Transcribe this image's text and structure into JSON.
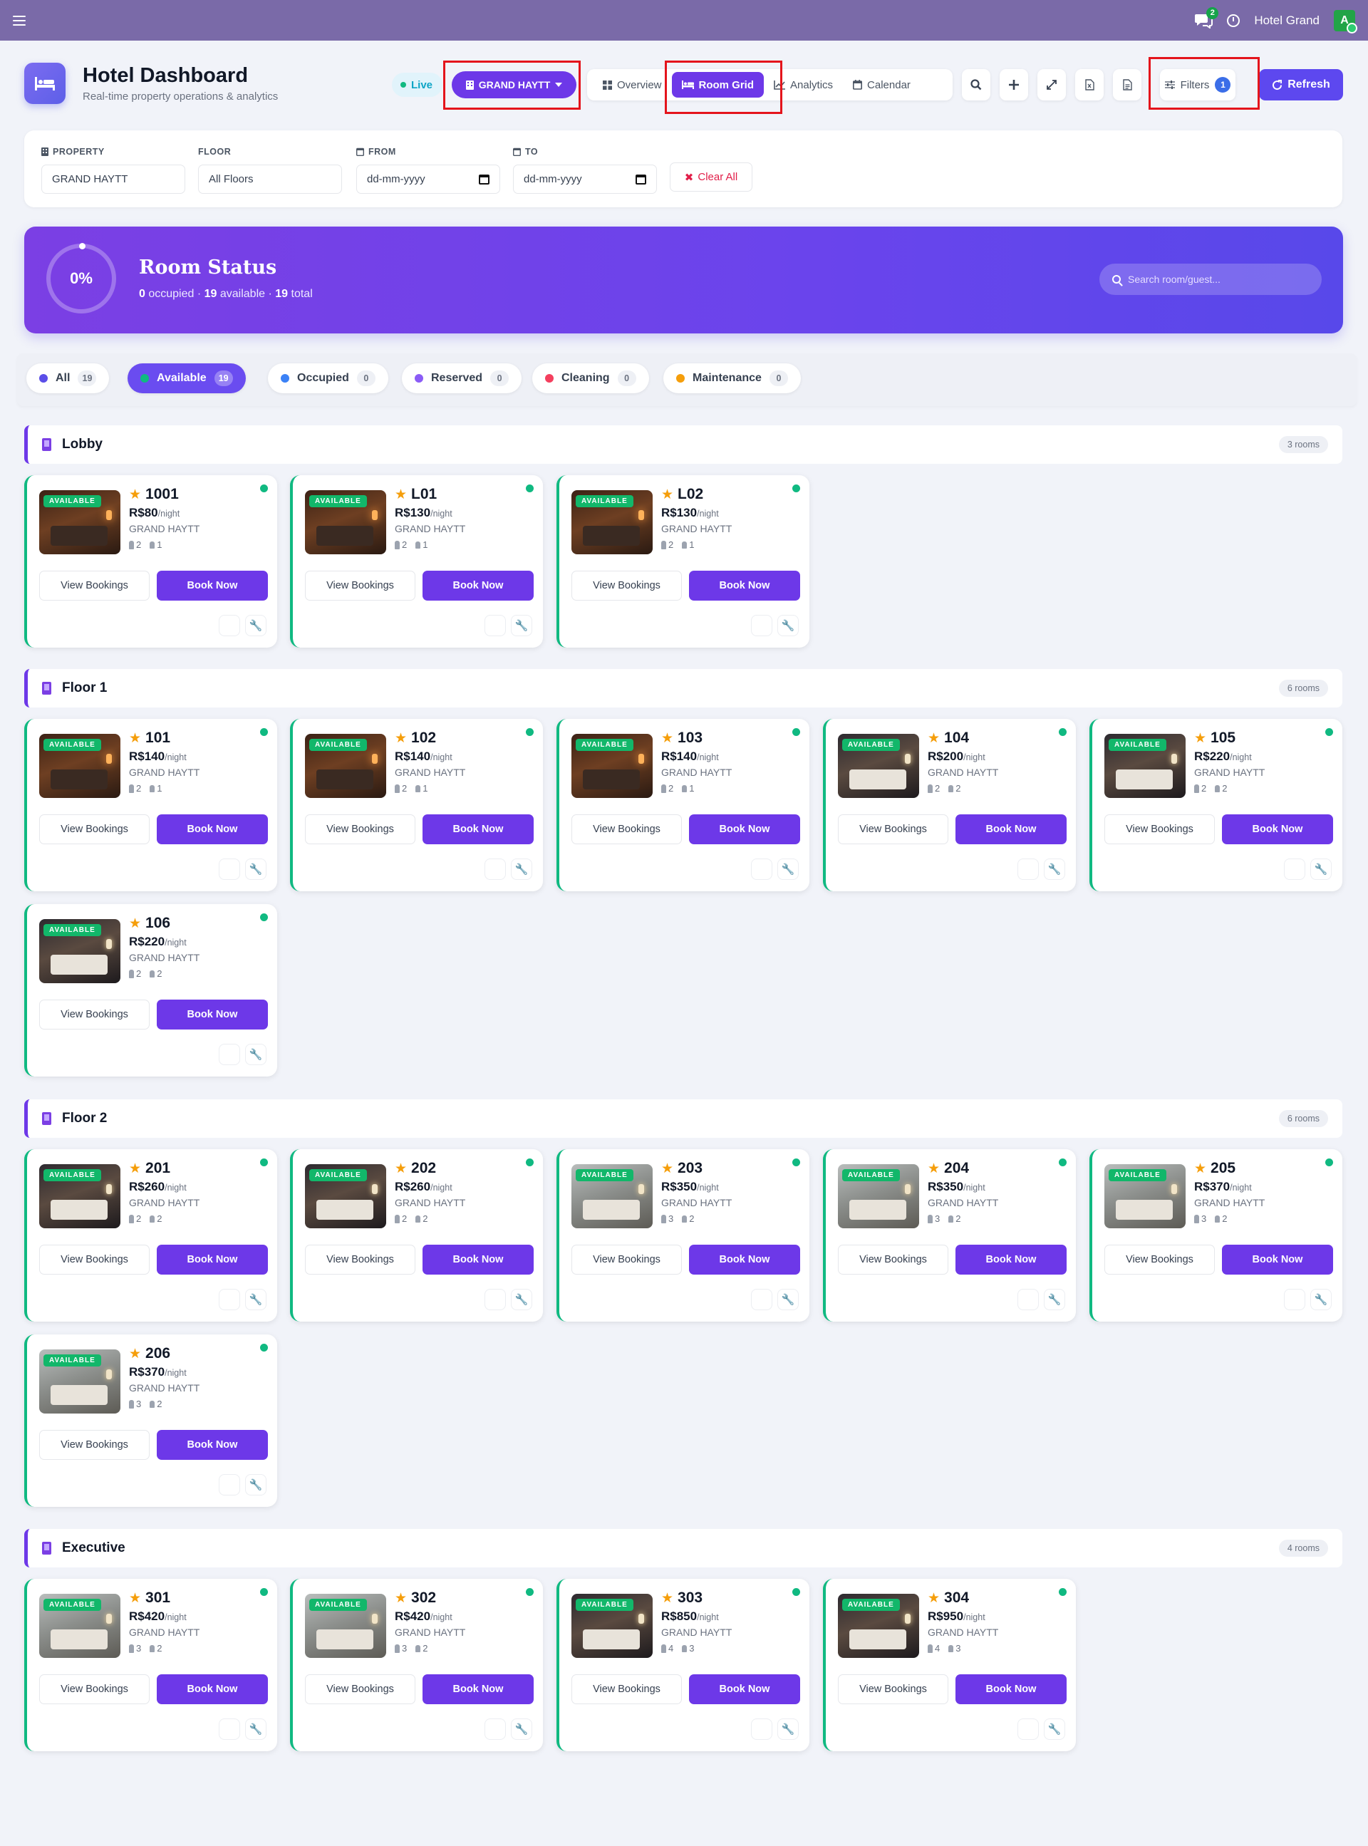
{
  "topbar": {
    "chat_count": "2",
    "user_name": "Hotel Grand",
    "avatar_initial": "A"
  },
  "header": {
    "title": "Hotel Dashboard",
    "subtitle": "Real-time property operations & analytics",
    "live_label": "Live",
    "property_selector": "GRAND HAYTT",
    "tabs": [
      {
        "label": "Overview",
        "icon": "grid-icon"
      },
      {
        "label": "Room Grid",
        "icon": "bed-icon",
        "active": true
      },
      {
        "label": "Analytics",
        "icon": "chart-line-icon"
      },
      {
        "label": "Calendar",
        "icon": "calendar-icon"
      }
    ],
    "filters_label": "Filters",
    "filters_count": "1",
    "refresh_label": "Refresh"
  },
  "filters": {
    "property_label": "PROPERTY",
    "property_value": "GRAND HAYTT",
    "floor_label": "FLOOR",
    "floor_value": "All Floors",
    "from_label": "FROM",
    "from_placeholder": "dd-mm-yyyy",
    "to_label": "TO",
    "to_placeholder": "dd-mm-yyyy",
    "clear_label": "Clear All"
  },
  "status": {
    "percent": "0%",
    "title": "Room Status",
    "occupied": "0",
    "occupied_label": "occupied",
    "available": "19",
    "available_label": "available",
    "total": "19",
    "total_label": "total",
    "search_placeholder": "Search room/guest..."
  },
  "chips": [
    {
      "label": "All",
      "count": "19",
      "color": "#5b4ee8"
    },
    {
      "label": "Available",
      "count": "19",
      "color": "#10b981",
      "active": true
    },
    {
      "label": "Occupied",
      "count": "0",
      "color": "#3b82f6"
    },
    {
      "label": "Reserved",
      "count": "0",
      "color": "#8b5cf6"
    },
    {
      "label": "Cleaning",
      "count": "0",
      "color": "#f43f5e"
    },
    {
      "label": "Maintenance",
      "count": "0",
      "color": "#f59e0b"
    }
  ],
  "card_labels": {
    "badge": "AVAILABLE",
    "per_night": "/night",
    "view_bookings": "View Bookings",
    "book_now": "Book Now"
  },
  "sections": [
    {
      "title": "Lobby",
      "count": "3 rooms",
      "rooms": [
        {
          "number": "1001",
          "price": "R$80",
          "hotel": "GRAND HAYTT",
          "adults": "2",
          "children": "1",
          "image": "warm"
        },
        {
          "number": "L01",
          "price": "R$130",
          "hotel": "GRAND HAYTT",
          "adults": "2",
          "children": "1",
          "image": "warm"
        },
        {
          "number": "L02",
          "price": "R$130",
          "hotel": "GRAND HAYTT",
          "adults": "2",
          "children": "1",
          "image": "warm"
        }
      ]
    },
    {
      "title": "Floor 1",
      "count": "6 rooms",
      "rooms": [
        {
          "number": "101",
          "price": "R$140",
          "hotel": "GRAND HAYTT",
          "adults": "2",
          "children": "1",
          "image": "warm"
        },
        {
          "number": "102",
          "price": "R$140",
          "hotel": "GRAND HAYTT",
          "adults": "2",
          "children": "1",
          "image": "warm"
        },
        {
          "number": "103",
          "price": "R$140",
          "hotel": "GRAND HAYTT",
          "adults": "2",
          "children": "1",
          "image": "warm"
        },
        {
          "number": "104",
          "price": "R$200",
          "hotel": "GRAND HAYTT",
          "adults": "2",
          "children": "2",
          "image": "dark"
        },
        {
          "number": "105",
          "price": "R$220",
          "hotel": "GRAND HAYTT",
          "adults": "2",
          "children": "2",
          "image": "dark"
        },
        {
          "number": "106",
          "price": "R$220",
          "hotel": "GRAND HAYTT",
          "adults": "2",
          "children": "2",
          "image": "dark"
        }
      ]
    },
    {
      "title": "Floor 2",
      "count": "6 rooms",
      "rooms": [
        {
          "number": "201",
          "price": "R$260",
          "hotel": "GRAND HAYTT",
          "adults": "2",
          "children": "2",
          "image": "dark"
        },
        {
          "number": "202",
          "price": "R$260",
          "hotel": "GRAND HAYTT",
          "adults": "2",
          "children": "2",
          "image": "dark"
        },
        {
          "number": "203",
          "price": "R$350",
          "hotel": "GRAND HAYTT",
          "adults": "3",
          "children": "2",
          "image": "cool"
        },
        {
          "number": "204",
          "price": "R$350",
          "hotel": "GRAND HAYTT",
          "adults": "3",
          "children": "2",
          "image": "cool"
        },
        {
          "number": "205",
          "price": "R$370",
          "hotel": "GRAND HAYTT",
          "adults": "3",
          "children": "2",
          "image": "cool"
        },
        {
          "number": "206",
          "price": "R$370",
          "hotel": "GRAND HAYTT",
          "adults": "3",
          "children": "2",
          "image": "cool"
        }
      ]
    },
    {
      "title": "Executive",
      "count": "4 rooms",
      "rooms": [
        {
          "number": "301",
          "price": "R$420",
          "hotel": "GRAND HAYTT",
          "adults": "3",
          "children": "2",
          "image": "cool"
        },
        {
          "number": "302",
          "price": "R$420",
          "hotel": "GRAND HAYTT",
          "adults": "3",
          "children": "2",
          "image": "cool"
        },
        {
          "number": "303",
          "price": "R$850",
          "hotel": "GRAND HAYTT",
          "adults": "4",
          "children": "3",
          "image": "dark"
        },
        {
          "number": "304",
          "price": "R$950",
          "hotel": "GRAND HAYTT",
          "adults": "4",
          "children": "3",
          "image": "dark"
        }
      ]
    }
  ]
}
